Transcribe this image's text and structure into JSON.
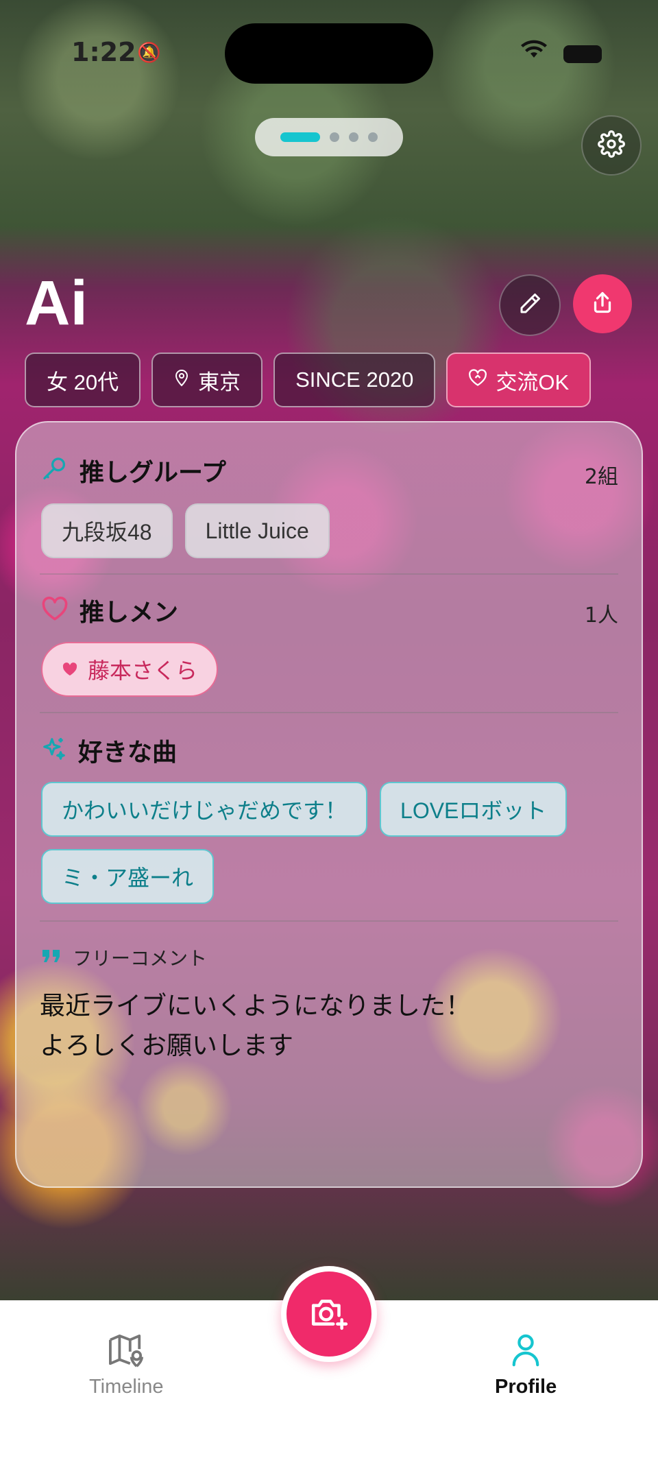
{
  "status_bar": {
    "time": "1:22",
    "mute_icon": "bell-slash-icon",
    "wifi_icon": "wifi-icon",
    "battery_icon": "battery-icon"
  },
  "pager": {
    "pages": 4,
    "active": 0
  },
  "settings_icon": "gear-icon",
  "profile": {
    "name": "Ai",
    "tags": {
      "gender_age": "女 20代",
      "location": "東京",
      "since": "SINCE 2020",
      "exchange": "交流OK"
    }
  },
  "sections": {
    "groups": {
      "title": "推しグループ",
      "count": "2組",
      "items": [
        "九段坂48",
        "Little Juice"
      ]
    },
    "members": {
      "title": "推しメン",
      "count": "1人",
      "items": [
        "藤本さくら"
      ]
    },
    "songs": {
      "title": "好きな曲",
      "items": [
        "かわいいだけじゃだめです！",
        "LOVEロボット",
        "ミ・ア盛ーれ"
      ]
    },
    "comment": {
      "title": "フリーコメント",
      "body": "最近ライブにいくようになりました！\nよろしくお願いします"
    }
  },
  "tabbar": {
    "timeline": "Timeline",
    "profile": "Profile"
  },
  "colors": {
    "accent_pink": "#f02a6a",
    "accent_teal": "#16c5cf"
  }
}
